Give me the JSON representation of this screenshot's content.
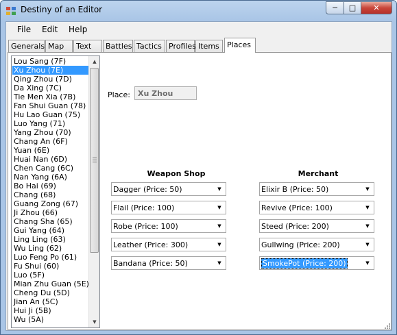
{
  "window": {
    "title": "Destiny of an Editor"
  },
  "menu": [
    "File",
    "Edit",
    "Help"
  ],
  "tabs": [
    "Generals",
    "Map",
    "Text",
    "Battles",
    "Tactics",
    "Profiles",
    "Items",
    "Places"
  ],
  "active_tab": "Places",
  "places": {
    "items": [
      "Lou Sang (7F)",
      "Xu Zhou (7E)",
      "Qing Zhou (7D)",
      "Da Xing (7C)",
      "Tie Men Xia (7B)",
      "Fan Shui Guan (78)",
      "Hu Lao Guan (75)",
      "Luo Yang (71)",
      "Yang Zhou (70)",
      "Chang An (6F)",
      "Yuan (6E)",
      "Huai Nan (6D)",
      "Chen Cang (6C)",
      "Nan Yang (6A)",
      "Bo Hai (69)",
      "Chang (68)",
      "Guang Zong (67)",
      "Ji Zhou (66)",
      "Chang Sha (65)",
      "Gui Yang (64)",
      "Ling Ling (63)",
      "Wu Ling (62)",
      "Luo Feng Po (61)",
      "Fu Shui (60)",
      "Luo (5F)",
      "Mian Zhu Guan (5E)",
      "Cheng Du (5D)",
      "Jian An (5C)",
      "Hui Ji (5B)",
      "Wu (5A)"
    ],
    "selected": "Xu Zhou (7E)"
  },
  "place_field": {
    "label": "Place:",
    "value": "Xu Zhou"
  },
  "weapon_shop": {
    "title": "Weapon Shop",
    "items": [
      "Dagger (Price: 50)",
      "Flail (Price: 100)",
      "Robe (Price: 100)",
      "Leather (Price: 300)",
      "Bandana (Price: 50)"
    ]
  },
  "merchant": {
    "title": "Merchant",
    "items": [
      "Elixir B (Price: 50)",
      "Revive (Price: 100)",
      "Steed (Price: 200)",
      "Gullwing (Price: 200)",
      "SmokePot (Price: 200)"
    ],
    "focused_index": 4
  },
  "colors": {
    "selection": "#3399ff",
    "title_bar": "#a9c5e6",
    "close_button": "#c9463a"
  }
}
